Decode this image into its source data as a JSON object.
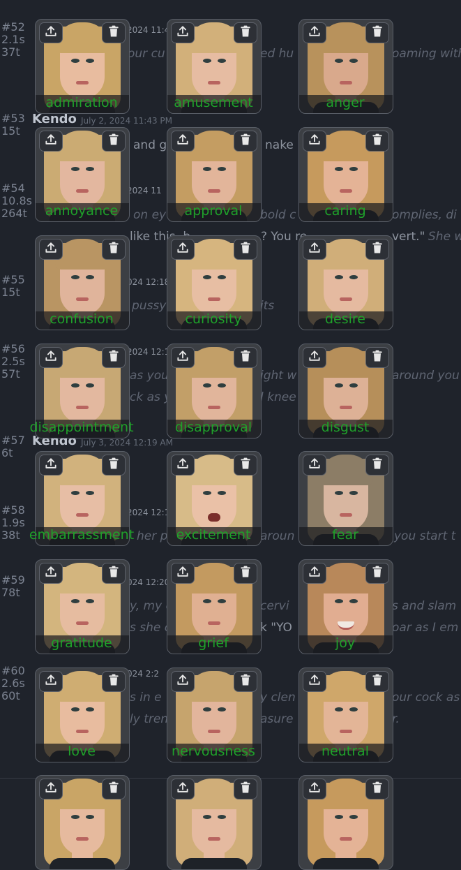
{
  "chat": {
    "metas": [
      {
        "id": "#52",
        "time": "2.1s",
        "tokens": "37t"
      },
      {
        "id": "#53",
        "time": "",
        "tokens": "15t"
      },
      {
        "id": "#54",
        "time": "10.8s",
        "tokens": "264t"
      },
      {
        "id": "#55",
        "time": "",
        "tokens": "15t"
      },
      {
        "id": "#56",
        "time": "2.5s",
        "tokens": "57t"
      },
      {
        "id": "#57",
        "time": "",
        "tokens": "6t"
      },
      {
        "id": "#58",
        "time": "1.9s",
        "tokens": "38t"
      },
      {
        "id": "#59",
        "time": "",
        "tokens": "78t"
      },
      {
        "id": "#60",
        "time": "2.6s",
        "tokens": "60t"
      }
    ],
    "names": [
      {
        "name": "Kendo",
        "date": "July 2, 2024 11:43 PM"
      },
      {
        "name": "Kendo",
        "date": "July 3, 2024 12:19 AM"
      }
    ],
    "fragments": [
      "2024 11:4",
      "our cu",
      "ed hu",
      "oaming with",
      "and g",
      "nake",
      "2024 11",
      "on ey",
      "bold c",
      "omplies, di",
      "like this, b",
      "? You re",
      "vert.\"",
      "She w",
      "024 12:18 A",
      "pussy",
      "its",
      "2024 12:1",
      "as you",
      "ight w",
      "around you",
      "ck as y",
      "l knee",
      "2024 12:1",
      "her p",
      "aroun",
      "you start t",
      "024 12:20 A",
      "y, my c",
      "cervi",
      "s and slam",
      "s she c",
      "k \"YO",
      "oar as I em",
      "024 2:2",
      "s in e",
      "y clen",
      "our cock as",
      "ly tren",
      "asure",
      "r."
    ]
  },
  "gallery": {
    "actions": {
      "upload": "upload-icon",
      "delete": "trash-icon"
    },
    "label_color": "#1fa12a",
    "cards": [
      {
        "label": "admiration",
        "hair": "#c9a566",
        "skin": "#e8bc9f",
        "mouth": "closed"
      },
      {
        "label": "amusement",
        "hair": "#d2b07a",
        "skin": "#e6bca2",
        "mouth": "closed"
      },
      {
        "label": "anger",
        "hair": "#b8925c",
        "skin": "#d9a98c",
        "mouth": "closed"
      },
      {
        "label": "annoyance",
        "hair": "#cbab73",
        "skin": "#e3b79f",
        "mouth": "closed"
      },
      {
        "label": "approval",
        "hair": "#c49d62",
        "skin": "#e2b59a",
        "mouth": "closed"
      },
      {
        "label": "caring",
        "hair": "#c69a5d",
        "skin": "#e4b396",
        "mouth": "closed"
      },
      {
        "label": "confusion",
        "hair": "#b99563",
        "skin": "#e0b49b",
        "mouth": "closed"
      },
      {
        "label": "curiosity",
        "hair": "#d6b57f",
        "skin": "#e7bea3",
        "mouth": "closed"
      },
      {
        "label": "desire",
        "hair": "#d0ae79",
        "skin": "#e5baa0",
        "mouth": "closed"
      },
      {
        "label": "disappointment",
        "hair": "#c7a874",
        "skin": "#e3b89f",
        "mouth": "closed"
      },
      {
        "label": "disapproval",
        "hair": "#c29f68",
        "skin": "#e1b59b",
        "mouth": "closed"
      },
      {
        "label": "disgust",
        "hair": "#b68f5a",
        "skin": "#ddb196",
        "mouth": "closed"
      },
      {
        "label": "embarrassment",
        "hair": "#d1b27d",
        "skin": "#e7bea5",
        "mouth": "closed"
      },
      {
        "label": "excitement",
        "hair": "#d7bb88",
        "skin": "#eac1a7",
        "mouth": "open"
      },
      {
        "label": "fear",
        "hair": "#8c7d66",
        "skin": "#d8b6a0",
        "mouth": "closed"
      },
      {
        "label": "gratitude",
        "hair": "#d3b57e",
        "skin": "#e6bca0",
        "mouth": "closed"
      },
      {
        "label": "grief",
        "hair": "#c39a60",
        "skin": "#e0b092",
        "mouth": "closed"
      },
      {
        "label": "joy",
        "hair": "#b8885a",
        "skin": "#e1ad91",
        "mouth": "smile"
      },
      {
        "label": "love",
        "hair": "#cfad72",
        "skin": "#e8bc9f",
        "mouth": "closed"
      },
      {
        "label": "nervousness",
        "hair": "#c6a46d",
        "skin": "#e2b59c",
        "mouth": "closed"
      },
      {
        "label": "neutral",
        "hair": "#cfa76a",
        "skin": "#e3b597",
        "mouth": "closed"
      },
      {
        "label": "",
        "hair": "#c9a566",
        "skin": "#e6ba9e",
        "mouth": "closed"
      },
      {
        "label": "",
        "hair": "#d0ae79",
        "skin": "#e5baa0",
        "mouth": "closed"
      },
      {
        "label": "",
        "hair": "#c69a5d",
        "skin": "#e4b396",
        "mouth": "closed"
      }
    ]
  }
}
